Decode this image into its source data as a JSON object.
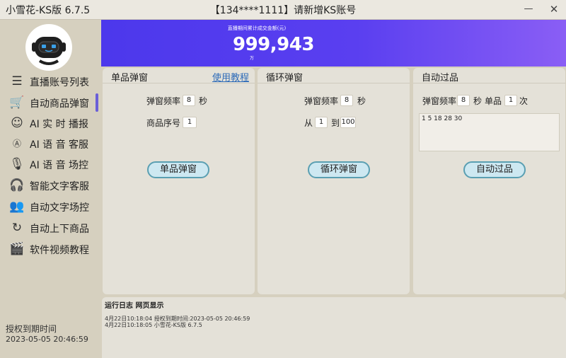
{
  "titlebar": {
    "app_title": "小雪花-KS版 6.7.5",
    "account_title": "【134****1111】请新增KS账号",
    "minimize": "—",
    "close": "✕"
  },
  "sidebar": {
    "items": [
      {
        "label": "直播账号列表",
        "icon": "list-icon"
      },
      {
        "label": "自动商品弹窗",
        "icon": "cart-icon",
        "active": true
      },
      {
        "label": "AI 实 时 播报",
        "icon": "robot-face-icon"
      },
      {
        "label": "AI 语 音 客服",
        "icon": "ai-chat-icon"
      },
      {
        "label": "AI 语 音 场控",
        "icon": "microphone-icon"
      },
      {
        "label": "智能文字客服",
        "icon": "headset-icon"
      },
      {
        "label": "自动文字场控",
        "icon": "users-icon"
      },
      {
        "label": "自动上下商品",
        "icon": "refresh-icon"
      },
      {
        "label": "软件视频教程",
        "icon": "video-icon"
      }
    ],
    "expiry_label": "授权到期时间",
    "expiry_date": "2023-05-05 20:46:59"
  },
  "banner": {
    "caption": "直播期间累计成交金额(元)",
    "amount": "999,943",
    "unit": "万"
  },
  "panels": {
    "single": {
      "title": "单品弹窗",
      "tutorial_link": "使用教程",
      "freq_label": "弹窗频率",
      "freq_value": "8",
      "freq_unit": "秒",
      "index_label": "商品序号",
      "index_value": "1",
      "button": "单品弹窗"
    },
    "loop": {
      "title": "循环弹窗",
      "freq_label": "弹窗频率",
      "freq_value": "8",
      "freq_unit": "秒",
      "from_label": "从",
      "from_value": "1",
      "to_label": "到",
      "to_value": "100",
      "button": "循环弹窗"
    },
    "auto": {
      "title": "自动过品",
      "freq_label": "弹窗频率",
      "freq_value": "8",
      "freq_unit": "秒",
      "single_label": "单品",
      "single_value": "1",
      "times_label": "次",
      "sequence": "1 5 18 28 30",
      "button": "自动过品"
    }
  },
  "log": {
    "title": "运行日志 网页显示",
    "lines": [
      "4月22日10:18:04 授权到期时间:2023-05-05 20:46:59",
      "4月22日10:18:05 小雪花-KS版 6.7.5"
    ]
  },
  "colors": {
    "accent": "#6a5fd8",
    "banner_start": "#4c38ec",
    "banner_end": "#8a5ef5",
    "button_fill": "#cde8f1",
    "button_border": "#5a9fb2",
    "link": "#2e6bb8"
  }
}
